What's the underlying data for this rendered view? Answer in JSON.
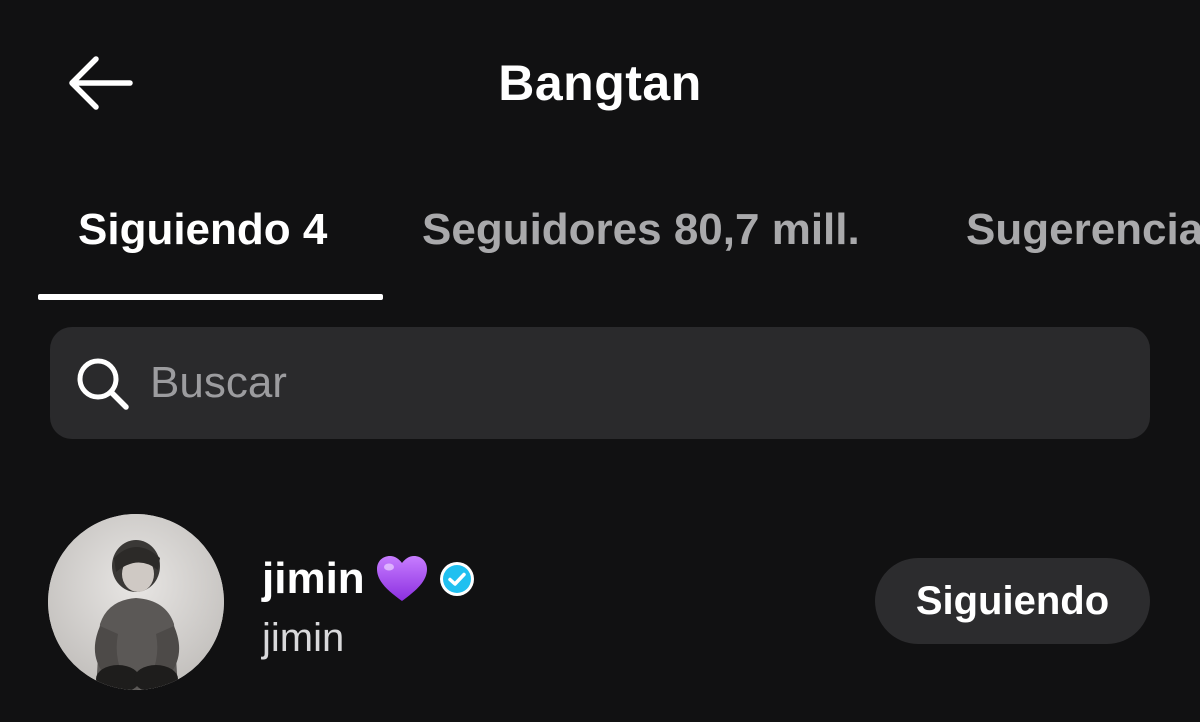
{
  "header": {
    "title": "Bangtan",
    "back_icon": "arrow-left-icon"
  },
  "tabs": [
    {
      "label": "Siguiendo 4",
      "active": true
    },
    {
      "label": "Seguidores 80,7 mill.",
      "active": false
    },
    {
      "label": "Sugerencia",
      "active": false
    }
  ],
  "search": {
    "placeholder": "Buscar",
    "value": "",
    "icon": "search-icon"
  },
  "list": [
    {
      "name": "jimin",
      "emoji": "purple-heart-icon",
      "verified": true,
      "handle": "jimin",
      "button_label": "Siguiendo"
    }
  ],
  "colors": {
    "background": "#111112",
    "search_background": "#2a2a2c",
    "button_background": "#2c2c2e",
    "inactive_tab": "#a9a9ab",
    "verified_badge": "#20c0f0",
    "heart": "#a855f7"
  }
}
